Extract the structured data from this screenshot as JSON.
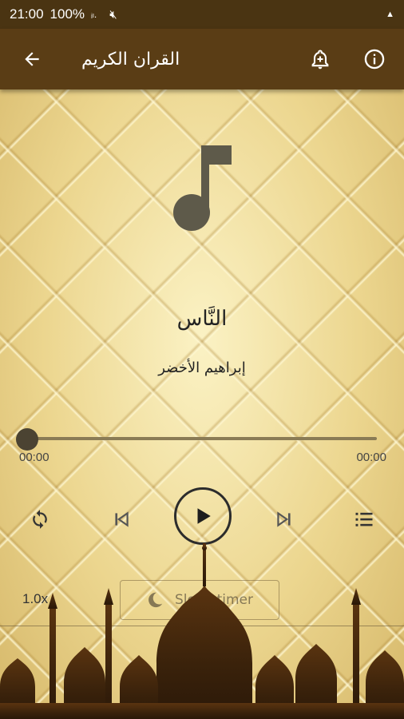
{
  "status_bar": {
    "time": "21:00",
    "battery": "100%",
    "signal_text": "ᵢₗ.",
    "right_glyph": "▲"
  },
  "toolbar": {
    "title": "القران الكريم",
    "back_icon": "arrow-left-icon",
    "alarm_icon": "alarm-add-icon",
    "info_icon": "info-icon"
  },
  "player": {
    "track_title": "النَّاس",
    "artist": "إبراهيم الأخضر",
    "progress": 0,
    "elapsed": "00:00",
    "duration": "00:00",
    "speed": "1.0x",
    "sleep_timer_label": "Sleep timer"
  },
  "colors": {
    "toolbar": "#5a3d15",
    "status_bar": "#4a3412",
    "note_icon": "#5e5a4a",
    "accent_dark": "#2c2c2c"
  }
}
